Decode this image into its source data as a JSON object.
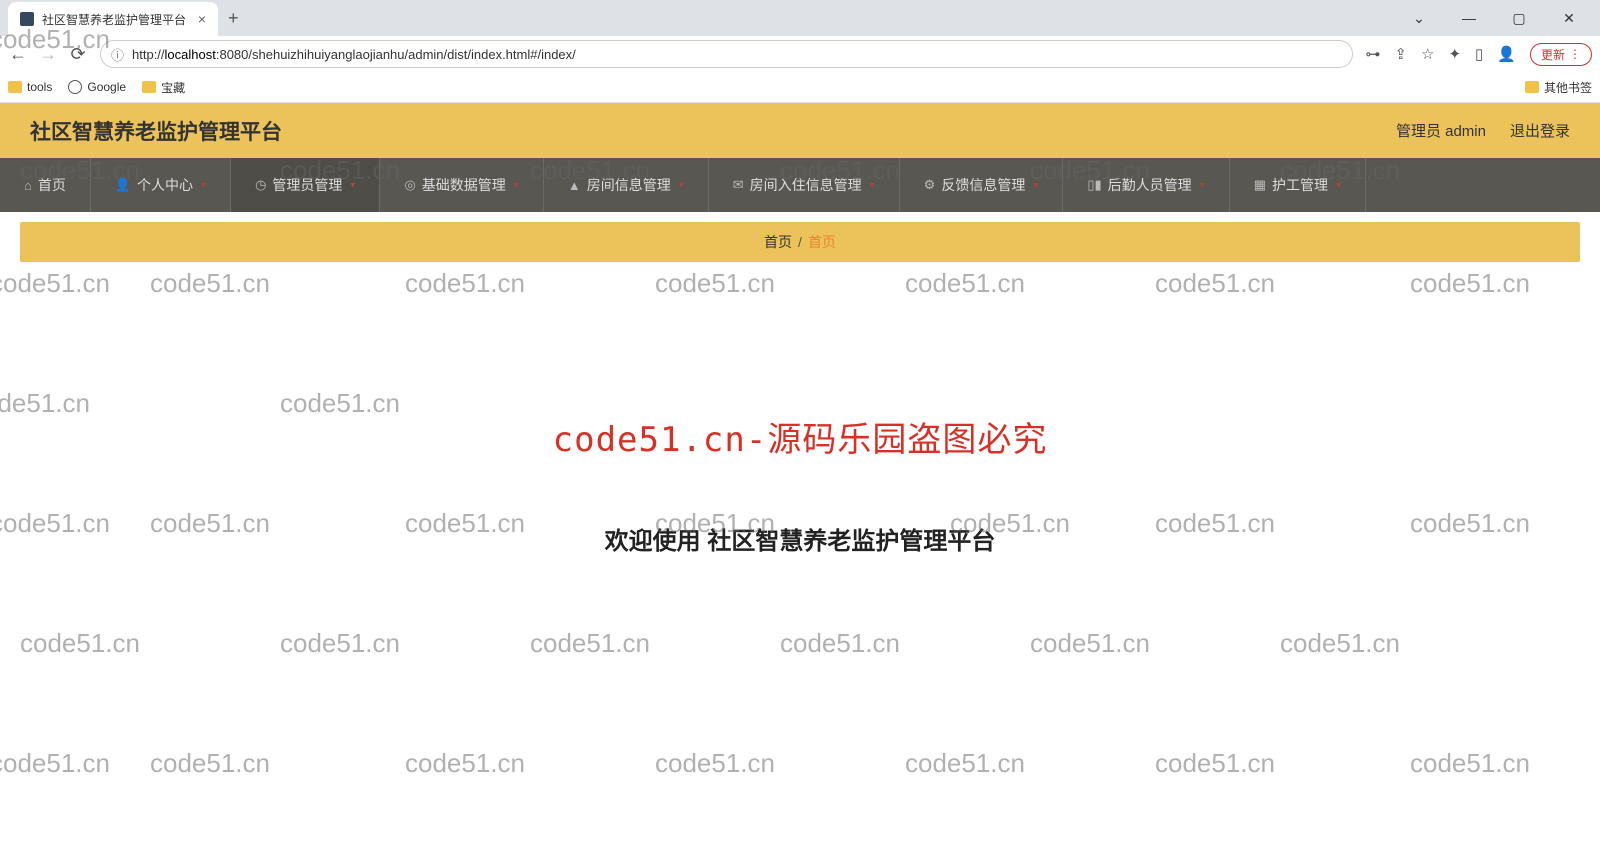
{
  "browser": {
    "tab_title": "社区智慧养老监护管理平台",
    "url_prefix": "http://",
    "url_host": "localhost",
    "url_path": ":8080/shehuizhihuiyanglaojianhu/admin/dist/index.html#/index/",
    "new_tab": "+",
    "update_label": "更新",
    "bookmarks": {
      "tools": "tools",
      "google": "Google",
      "treasure": "宝藏",
      "other": "其他书签"
    }
  },
  "header": {
    "title": "社区智慧养老监护管理平台",
    "user_label": "管理员 admin",
    "logout": "退出登录"
  },
  "nav": {
    "home": "首页",
    "personal": "个人中心",
    "admin_mgmt": "管理员管理",
    "basic_data": "基础数据管理",
    "room_info": "房间信息管理",
    "room_checkin": "房间入住信息管理",
    "feedback": "反馈信息管理",
    "logistics": "后勤人员管理",
    "nurse": "护工管理"
  },
  "breadcrumb": {
    "root": "首页",
    "sep": "/",
    "current": "首页"
  },
  "content": {
    "watermark": "code51.cn-源码乐园盗图必究",
    "welcome": "欢迎使用 社区智慧养老监护管理平台"
  },
  "bg_watermark": "code51.cn"
}
